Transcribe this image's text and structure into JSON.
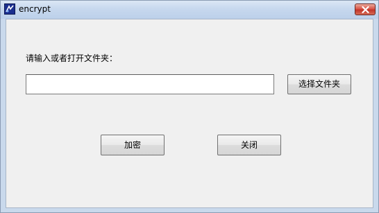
{
  "window": {
    "title": "encrypt"
  },
  "titlebar": {
    "app_icon": "app-icon",
    "close_icon": "close-icon"
  },
  "form": {
    "prompt_label": "请输入或者打开文件夹：",
    "path_value": "",
    "browse_button": "选择文件夹",
    "encrypt_button": "加密",
    "close_button": "关闭"
  },
  "colors": {
    "titlebar": "#c7d8ee",
    "client_bg": "#f0f0f0",
    "close_button": "#c2352a"
  }
}
